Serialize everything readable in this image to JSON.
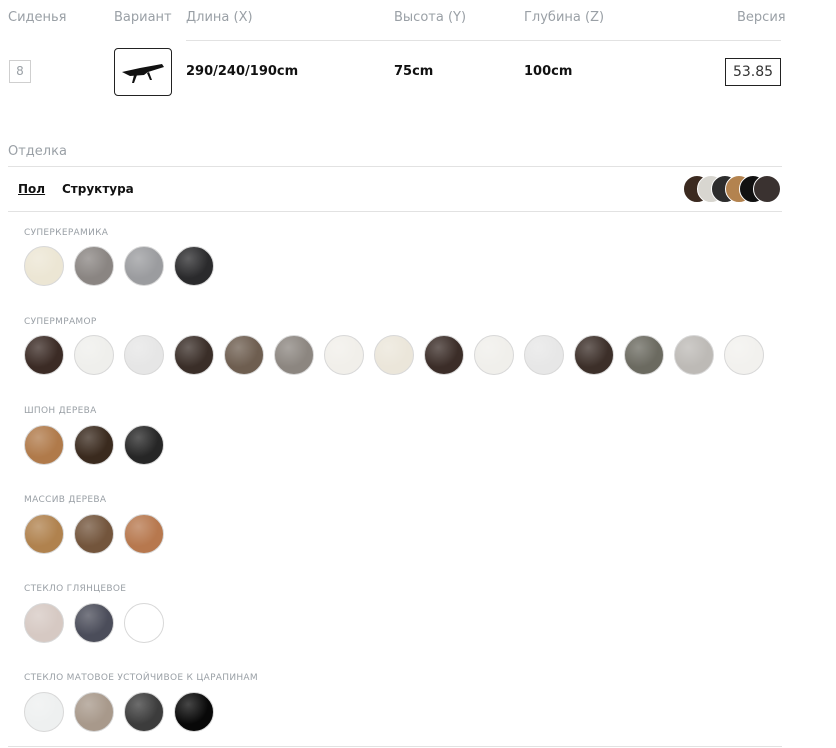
{
  "headers": {
    "seats": "Сиденья",
    "variant": "Вариант",
    "length": "Длина (X)",
    "height": "Высота (Y)",
    "depth": "Глубина (Z)",
    "version": "Версия"
  },
  "row": {
    "seats": "8",
    "variant_icon": "table-icon",
    "length": "290/240/190cm",
    "height": "75cm",
    "depth": "100cm",
    "version": "53.85"
  },
  "finish": {
    "label": "Отделка",
    "tabs": [
      "Пол",
      "Структура"
    ],
    "active_tab": "Пол",
    "selected_preview_colors": [
      "#3b2a20",
      "#d8d6d0",
      "#2d2d2d",
      "#b3834f",
      "#111111",
      "#3a3230"
    ]
  },
  "categories": [
    {
      "title": "СУПЕРКЕРАМИКА",
      "swatches": [
        "#ece6d4",
        "#8a8582",
        "#9b9c9f",
        "#2a2a2c"
      ]
    },
    {
      "title": "СУПЕРМРАМОР",
      "swatches": [
        "#3b2b25",
        "#efefec",
        "#e6e6e6",
        "#3a2e28",
        "#6e5e50",
        "#8c8680",
        "#f1efea",
        "#ebe6da",
        "#3b2d28",
        "#f0efeb",
        "#e7e7e7",
        "#3c2f29",
        "#6b6a60",
        "#bdbab6",
        "#f2f1ee"
      ]
    },
    {
      "title": "ШПОН ДЕРЕВА",
      "swatches": [
        "#b07a4a",
        "#3a2a1e",
        "#262626"
      ]
    },
    {
      "title": "МАССИВ ДЕРЕВА",
      "swatches": [
        "#b0824e",
        "#73553c",
        "#b7784e"
      ]
    },
    {
      "title": "СТЕКЛО ГЛЯНЦЕВОЕ",
      "swatches": [
        "#d6c9c3",
        "#4b4d5a",
        "#ffffff"
      ]
    },
    {
      "title": "СТЕКЛО МАТОВОЕ УСТОЙЧИВОЕ К ЦАРАПИНАМ",
      "swatches": [
        "#eef0f0",
        "#a8998b",
        "#3c3c3c",
        "#080808"
      ]
    }
  ]
}
